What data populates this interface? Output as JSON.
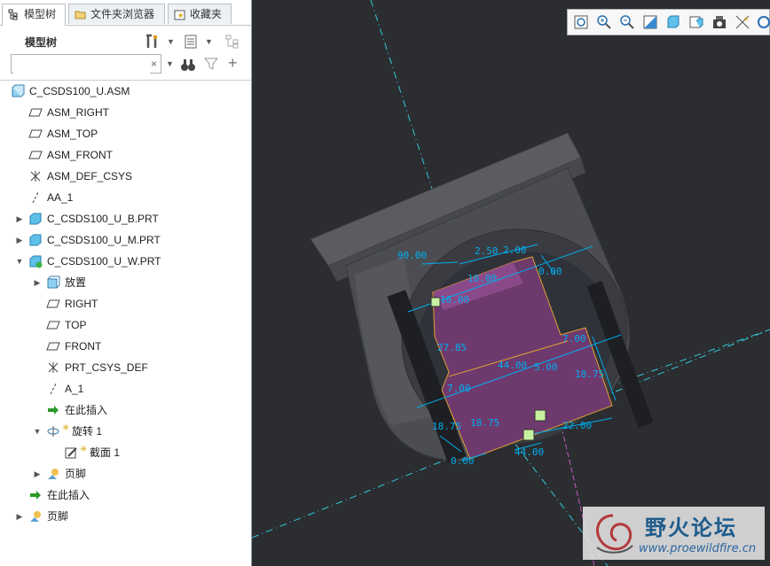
{
  "tabs": [
    {
      "label": "模型树"
    },
    {
      "label": "文件夹浏览器"
    },
    {
      "label": "收藏夹"
    }
  ],
  "panel": {
    "title": "模型树"
  },
  "search": {
    "value": "",
    "clear_label": "×"
  },
  "tree": [
    {
      "label": "C_CSDS100_U.ASM"
    },
    {
      "label": "ASM_RIGHT"
    },
    {
      "label": "ASM_TOP"
    },
    {
      "label": "ASM_FRONT"
    },
    {
      "label": "ASM_DEF_CSYS"
    },
    {
      "label": "AA_1"
    },
    {
      "label": "C_CSDS100_U_B.PRT"
    },
    {
      "label": "C_CSDS100_U_M.PRT"
    },
    {
      "label": "C_CSDS100_U_W.PRT"
    },
    {
      "label": "放置"
    },
    {
      "label": "RIGHT"
    },
    {
      "label": "TOP"
    },
    {
      "label": "FRONT"
    },
    {
      "label": "PRT_CSYS_DEF"
    },
    {
      "label": "A_1"
    },
    {
      "label": "在此插入"
    },
    {
      "label": "旋转 1"
    },
    {
      "label": "截面 1"
    },
    {
      "label": "页脚"
    },
    {
      "label": "在此插入"
    },
    {
      "label": "页脚"
    }
  ],
  "dimensions": [
    "90.00",
    "2.50",
    "2.00",
    "0.00",
    "10.00",
    "16.00",
    "27.85",
    "44.00",
    "5.00",
    "7.00",
    "18.75",
    "7.00",
    "18.75",
    "18.75",
    "22.00",
    "44.00",
    "0.00"
  ],
  "watermark": {
    "title": "野火论坛",
    "url": "www.proewildfire.cn"
  },
  "colors": {
    "viewport_bg": "#2b2d31",
    "section_fill": "#6e3a6e",
    "dimension": "#00aeef",
    "axis": "#33c9d6"
  }
}
